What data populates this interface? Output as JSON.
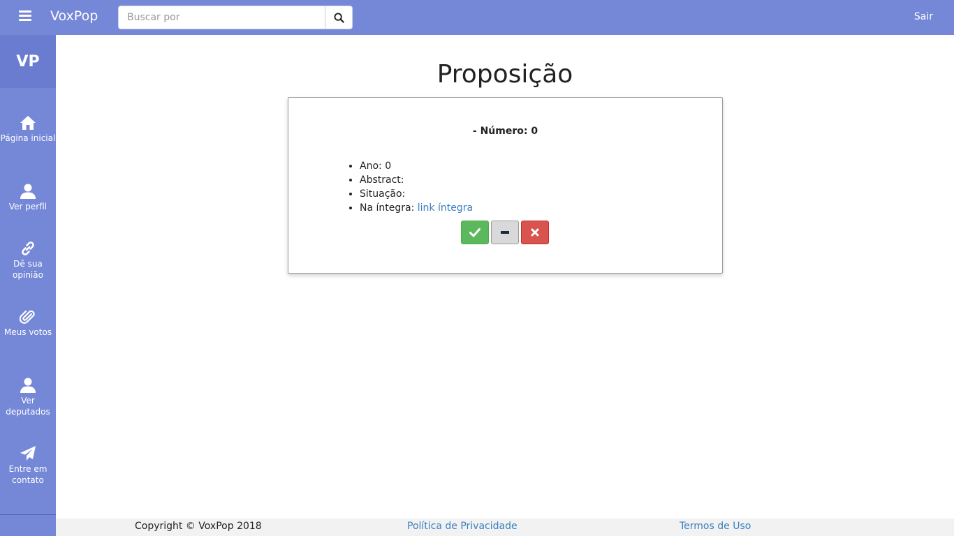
{
  "header": {
    "brand": "VoxPop",
    "search_placeholder": "Buscar por",
    "logout_label": "Sair"
  },
  "sidebar": {
    "logo": "VP",
    "items": [
      {
        "label": "Página inicial",
        "icon": "home-icon"
      },
      {
        "label": "Ver perfil",
        "icon": "user-icon"
      },
      {
        "label": "Dê sua opinião",
        "icon": "link-icon"
      },
      {
        "label": "Meus votos",
        "icon": "paperclip-icon"
      },
      {
        "label": "Ver deputados",
        "icon": "user-icon"
      },
      {
        "label": "Entre em contato",
        "icon": "paper-plane-icon"
      }
    ]
  },
  "main": {
    "title": "Proposição",
    "card": {
      "heading": "- Número: 0",
      "fields": [
        {
          "label": "Ano:",
          "value": "0"
        },
        {
          "label": "Abstract:",
          "value": ""
        },
        {
          "label": "Situação:",
          "value": ""
        },
        {
          "label": "Na íntegra:",
          "value": "link íntegra"
        }
      ]
    }
  },
  "footer": {
    "copyright": "Copyright © VoxPop 2018",
    "privacy_label": "Política de Privacidade",
    "terms_label": "Termos de Uso"
  },
  "colors": {
    "brand": "#7587d7",
    "approve": "#5cb85c",
    "reject": "#d9534f",
    "link": "#3a7fc1"
  }
}
